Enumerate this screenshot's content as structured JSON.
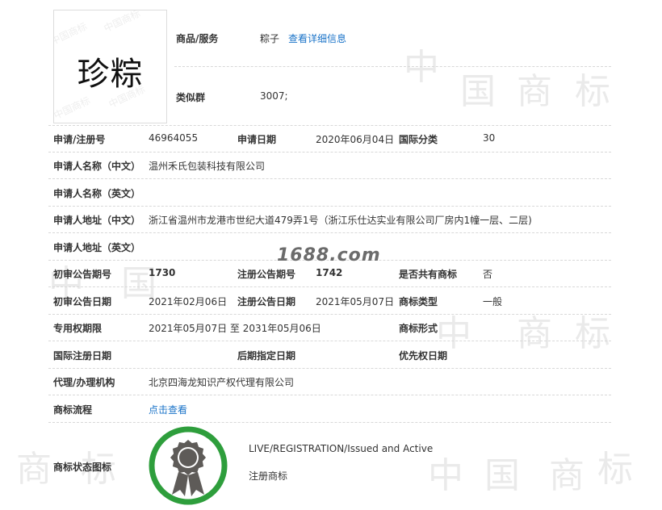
{
  "logo": {
    "text": "珍粽"
  },
  "goods": {
    "label": "商品/服务",
    "value": "粽子",
    "detail_link": "查看详细信息",
    "similar_label": "类似群",
    "similar_value": "3007;"
  },
  "registration": {
    "app_no_label": "申请/注册号",
    "app_no_value": "46964055",
    "app_date_label": "申请日期",
    "app_date_value": "2020年06月04日",
    "intl_class_label": "国际分类",
    "intl_class_value": "30"
  },
  "applicant": {
    "name_cn_label": "申请人名称（中文）",
    "name_cn_value": "温州禾氏包装科技有限公司",
    "name_en_label": "申请人名称（英文）",
    "addr_cn_label": "申请人地址（中文）",
    "addr_cn_value": "浙江省温州市龙港市世纪大道479弄1号（浙江乐仕达实业有限公司厂房内1幢一层、二层)",
    "addr_en_label": "申请人地址（英文）"
  },
  "announcement": {
    "prelim_no_label": "初审公告期号",
    "prelim_no_value": "1730",
    "reg_no_label": "注册公告期号",
    "reg_no_value": "1742",
    "shared_label": "是否共有商标",
    "shared_value": "否",
    "prelim_date_label": "初审公告日期",
    "prelim_date_value": "2021年02月06日",
    "reg_date_label": "注册公告日期",
    "reg_date_value": "2021年05月07日",
    "type_label": "商标类型",
    "type_value": "一般"
  },
  "rights": {
    "period_label": "专用权期限",
    "period_value": "2021年05月07日 至 2031年05月06日",
    "form_label": "商标形式",
    "intl_reg_date_label": "国际注册日期",
    "later_date_label": "后期指定日期",
    "priority_date_label": "优先权日期",
    "agent_label": "代理/办理机构",
    "agent_value": "北京四海龙知识产权代理有限公司",
    "process_label": "商标流程",
    "process_link": "点击查看"
  },
  "status": {
    "label": "商标状态图标",
    "en": "LIVE/REGISTRATION/Issued and Active",
    "cn": "注册商标",
    "ring_color": "#2e9e3c",
    "badge_color": "#5e5b58"
  },
  "site_watermark": "1688.com",
  "watermark_chars": [
    "中",
    "国",
    "商",
    "标"
  ],
  "logo_watermark": "中国商标"
}
